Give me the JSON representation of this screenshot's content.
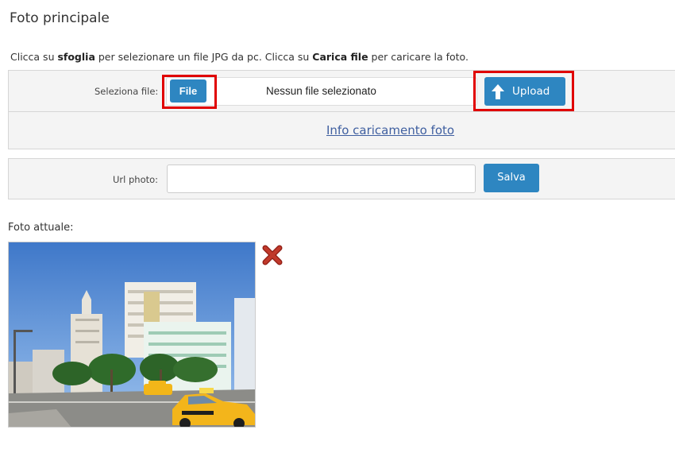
{
  "page": {
    "title": "Foto principale",
    "instructions": {
      "part1": "Clicca su ",
      "bold1": "sfoglia",
      "part2": " per selezionare un file JPG da pc. Clicca su ",
      "bold2": "Carica file",
      "part3": " per caricare la foto."
    }
  },
  "upload": {
    "label": "Seleziona file:",
    "file_button_label": "File",
    "no_file_text": "Nessun file selezionato",
    "upload_button_label": "Upload",
    "info_link": "Info caricamento foto"
  },
  "url": {
    "label": "Url photo:",
    "value": "",
    "placeholder": "",
    "save_button_label": "Salva"
  },
  "current_photo": {
    "label": "Foto attuale:",
    "delete_icon": "red-x-icon"
  },
  "colors": {
    "accent": "#2e86c1",
    "highlight": "#e00000",
    "link": "#3f5fa0",
    "delete": "#c0392b"
  }
}
